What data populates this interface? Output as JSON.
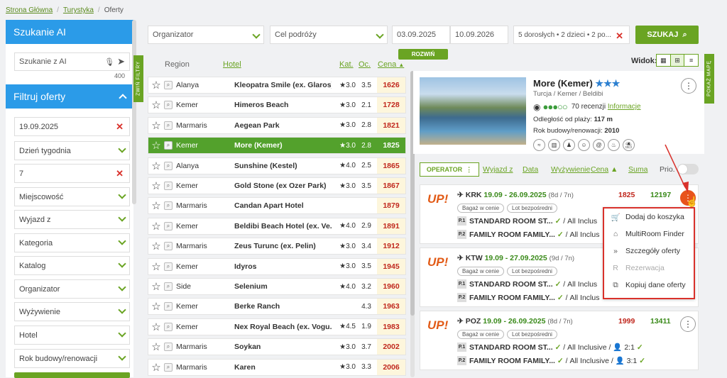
{
  "breadcrumb": {
    "items": [
      "Strona Główna",
      "Turystyka",
      "Oferty"
    ]
  },
  "ai_search": {
    "title": "Szukanie AI",
    "placeholder": "Szukanie z AI",
    "counter": "400"
  },
  "filters": {
    "title": "Filtruj oferty",
    "date": "19.09.2025",
    "weekday": "Dzień tygodnia",
    "days": "7",
    "city": "Miejscowość",
    "departure": "Wyjazd z",
    "category": "Kategoria",
    "catalog": "Katalog",
    "organizer": "Organizator",
    "board": "Wyżywienie",
    "hotel": "Hotel",
    "build_year": "Rok budowy/renowacji"
  },
  "side_tabs": {
    "collapse": "ZWIŃ FILTRY",
    "map": "POKAŻ MAPĘ"
  },
  "top": {
    "organizer": "Organizator",
    "destination": "Cel podróży",
    "date_from": "03.09.2025",
    "date_to": "10.09.2026",
    "people": "5 dorosłych • 2 dzieci • 2 po...",
    "search": "SZUKAJ",
    "expand": "ROZWIŃ",
    "view_label": "Widok:"
  },
  "list_head": {
    "region": "Region",
    "hotel": "Hotel",
    "cat": "Kat.",
    "occ": "Oc.",
    "price": "Cena"
  },
  "list": [
    {
      "region": "Alanya",
      "hotel": "Kleopatra Smile (ex. Glaros)",
      "cat": "★3.0",
      "occ": "3.5",
      "price": "1626"
    },
    {
      "region": "Kemer",
      "hotel": "Himeros Beach",
      "cat": "★3.0",
      "occ": "2.1",
      "price": "1728"
    },
    {
      "region": "Marmaris",
      "hotel": "Aegean Park",
      "cat": "★3.0",
      "occ": "2.8",
      "price": "1821"
    },
    {
      "region": "Kemer",
      "hotel": "More (Kemer)",
      "cat": "★3.0",
      "occ": "2.8",
      "price": "1825"
    },
    {
      "region": "Alanya",
      "hotel": "Sunshine (Kestel)",
      "cat": "★4.0",
      "occ": "2.5",
      "price": "1865"
    },
    {
      "region": "Kemer",
      "hotel": "Gold Stone (ex Ozer Park)",
      "cat": "★3.0",
      "occ": "3.5",
      "price": "1867"
    },
    {
      "region": "Marmaris",
      "hotel": "Candan Apart Hotel",
      "cat": "",
      "occ": "",
      "price": "1879"
    },
    {
      "region": "Kemer",
      "hotel": "Beldibi Beach Hotel (ex. Ve...",
      "cat": "★4.0",
      "occ": "2.9",
      "price": "1891"
    },
    {
      "region": "Marmaris",
      "hotel": "Zeus Turunc (ex. Pelin)",
      "cat": "★3.0",
      "occ": "3.4",
      "price": "1912"
    },
    {
      "region": "Kemer",
      "hotel": "Idyros",
      "cat": "★3.0",
      "occ": "3.5",
      "price": "1945"
    },
    {
      "region": "Side",
      "hotel": "Selenium",
      "cat": "★4.0",
      "occ": "3.2",
      "price": "1960"
    },
    {
      "region": "Kemer",
      "hotel": "Berke Ranch",
      "cat": "",
      "occ": "4.3",
      "price": "1963"
    },
    {
      "region": "Kemer",
      "hotel": "Nex Royal Beach (ex. Vogu...",
      "cat": "★4.5",
      "occ": "1.9",
      "price": "1983"
    },
    {
      "region": "Marmaris",
      "hotel": "Soykan",
      "cat": "★3.0",
      "occ": "3.7",
      "price": "2002"
    },
    {
      "region": "Marmaris",
      "hotel": "Karen",
      "cat": "★3.0",
      "occ": "3.3",
      "price": "2006"
    }
  ],
  "hotel": {
    "name": "More (Kemer)",
    "stars": "★★★",
    "location": "Turcja / Kemer / Beldibi",
    "reviews": "70 recenzji",
    "info": "Informacje",
    "beach_label": "Odległość od plaży:",
    "beach": "117 m",
    "year_label": "Rok budowy/renowacji:",
    "year": "2010"
  },
  "offer_head": {
    "operator": "OPERATOR",
    "departure": "Wyjazd z",
    "date": "Data",
    "board": "Wyżywienie",
    "price": "Cena",
    "sum": "Suma",
    "prio": "Prio."
  },
  "offers": [
    {
      "route": "KRK",
      "dates": "19.09 - 26.09.2025",
      "len": "(8d / 7n)",
      "price": "1825",
      "sum": "12197",
      "badge1": "Bagaż w cenie",
      "badge2": "Lot bezpośredni",
      "r1": "STANDARD ROOM ST...",
      "r2": "FAMILY ROOM FAMILY...",
      "board": "All Inclus"
    },
    {
      "route": "KTW",
      "dates": "19.09 - 27.09.2025",
      "len": "(9d / 7n)",
      "badge1": "Bagaż w cenie",
      "badge2": "Lot bezpośredni",
      "r1": "STANDARD ROOM ST...",
      "r2": "FAMILY ROOM FAMILY...",
      "board": "All Inclus"
    },
    {
      "route": "POZ",
      "dates": "19.09 - 26.09.2025",
      "len": "(8d / 7n)",
      "price": "1999",
      "sum": "13411",
      "badge1": "Bagaż w cenie",
      "badge2": "Lot bezpośredni",
      "r1": "STANDARD ROOM ST...",
      "r2": "FAMILY ROOM FAMILY...",
      "board": "All Inclusive",
      "occ1": "2:1",
      "occ2": "3:1"
    }
  ],
  "menu": {
    "cart": "Dodaj do koszyka",
    "multiroom": "MultiRoom Finder",
    "details": "Szczegóły oferty",
    "reserve": "Rezerwacja",
    "copy": "Kopiuj dane oferty"
  },
  "colors": {
    "green": "#6aa423",
    "blue": "#2b9be8",
    "red": "#d9312b"
  }
}
